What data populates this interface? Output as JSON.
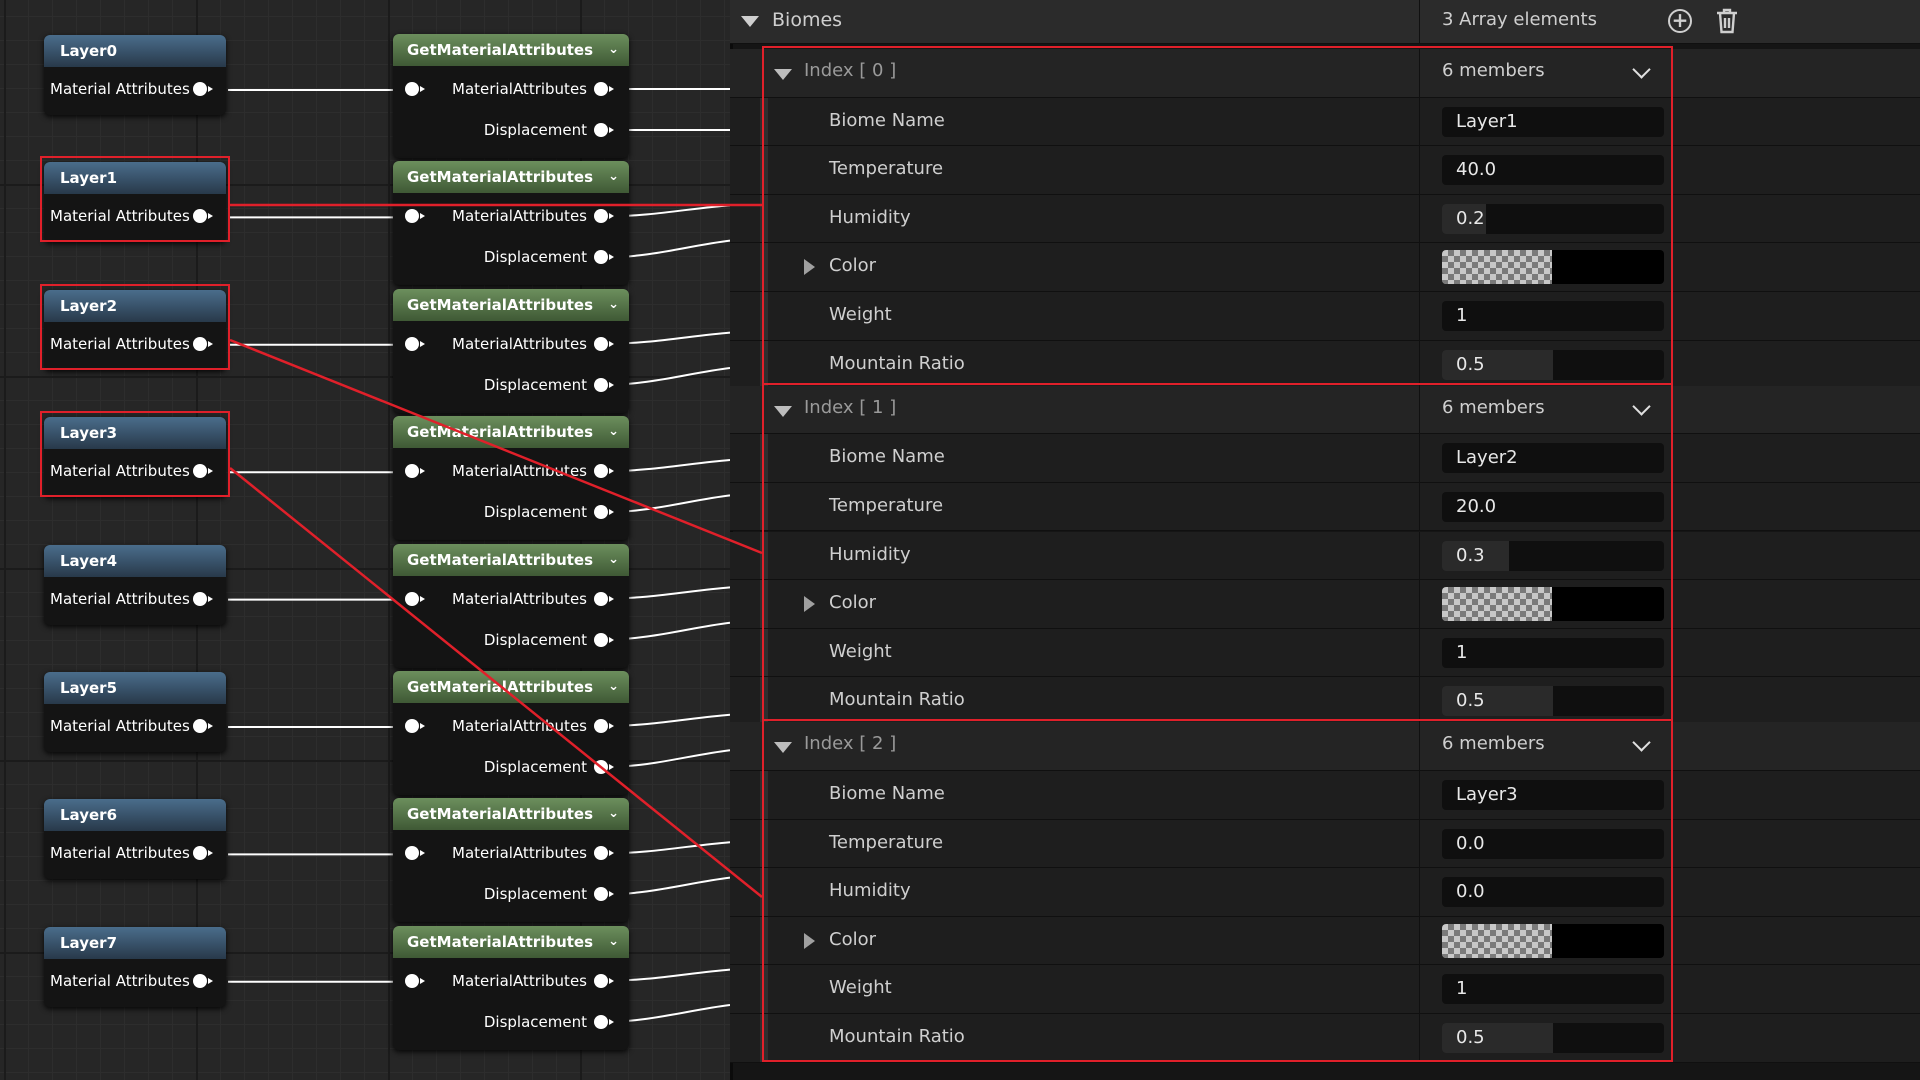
{
  "graph": {
    "layer_nodes": [
      {
        "title": "Layer0",
        "pin": "Material Attributes"
      },
      {
        "title": "Layer1",
        "pin": "Material Attributes"
      },
      {
        "title": "Layer2",
        "pin": "Material Attributes"
      },
      {
        "title": "Layer3",
        "pin": "Material Attributes"
      },
      {
        "title": "Layer4",
        "pin": "Material Attributes"
      },
      {
        "title": "Layer5",
        "pin": "Material Attributes"
      },
      {
        "title": "Layer6",
        "pin": "Material Attributes"
      },
      {
        "title": "Layer7",
        "pin": "Material Attributes"
      }
    ],
    "get_nodes": [
      {
        "title": "GetMaterialAttributes",
        "out1": "MaterialAttributes",
        "out2": "Displacement"
      },
      {
        "title": "GetMaterialAttributes",
        "out1": "MaterialAttributes",
        "out2": "Displacement"
      },
      {
        "title": "GetMaterialAttributes",
        "out1": "MaterialAttributes",
        "out2": "Displacement"
      },
      {
        "title": "GetMaterialAttributes",
        "out1": "MaterialAttributes",
        "out2": "Displacement"
      },
      {
        "title": "GetMaterialAttributes",
        "out1": "MaterialAttributes",
        "out2": "Displacement"
      },
      {
        "title": "GetMaterialAttributes",
        "out1": "MaterialAttributes",
        "out2": "Displacement"
      },
      {
        "title": "GetMaterialAttributes",
        "out1": "MaterialAttributes",
        "out2": "Displacement"
      },
      {
        "title": "GetMaterialAttributes",
        "out1": "MaterialAttributes",
        "out2": "Displacement"
      }
    ]
  },
  "details": {
    "biomes": {
      "label": "Biomes",
      "count": "3 Array elements",
      "add_icon": "plus-circle-icon",
      "delete_icon": "trash-icon"
    },
    "elements": [
      {
        "index": "Index [ 0 ]",
        "members": "6 members",
        "biome_name": "Layer1",
        "temperature": "40.0",
        "humidity": "0.2",
        "humidity_level": 0.2,
        "weight": "1",
        "mountain_ratio": "0.5",
        "mountain_ratio_level": 0.5
      },
      {
        "index": "Index [ 1 ]",
        "members": "6 members",
        "biome_name": "Layer2",
        "temperature": "20.0",
        "humidity": "0.3",
        "humidity_level": 0.3,
        "weight": "1",
        "mountain_ratio": "0.5",
        "mountain_ratio_level": 0.5
      },
      {
        "index": "Index [ 2 ]",
        "members": "6 members",
        "biome_name": "Layer3",
        "temperature": "0.0",
        "humidity": "0.0",
        "humidity_level": 0.0,
        "weight": "1",
        "mountain_ratio": "0.5",
        "mountain_ratio_level": 0.5
      }
    ],
    "field_labels": {
      "biome_name": "Biome Name",
      "temperature": "Temperature",
      "humidity": "Humidity",
      "color": "Color",
      "weight": "Weight",
      "mountain_ratio": "Mountain Ratio"
    }
  },
  "colors": {
    "highlight": "#e0202a",
    "layer_header": "#3b5670",
    "get_header": "#557847"
  }
}
